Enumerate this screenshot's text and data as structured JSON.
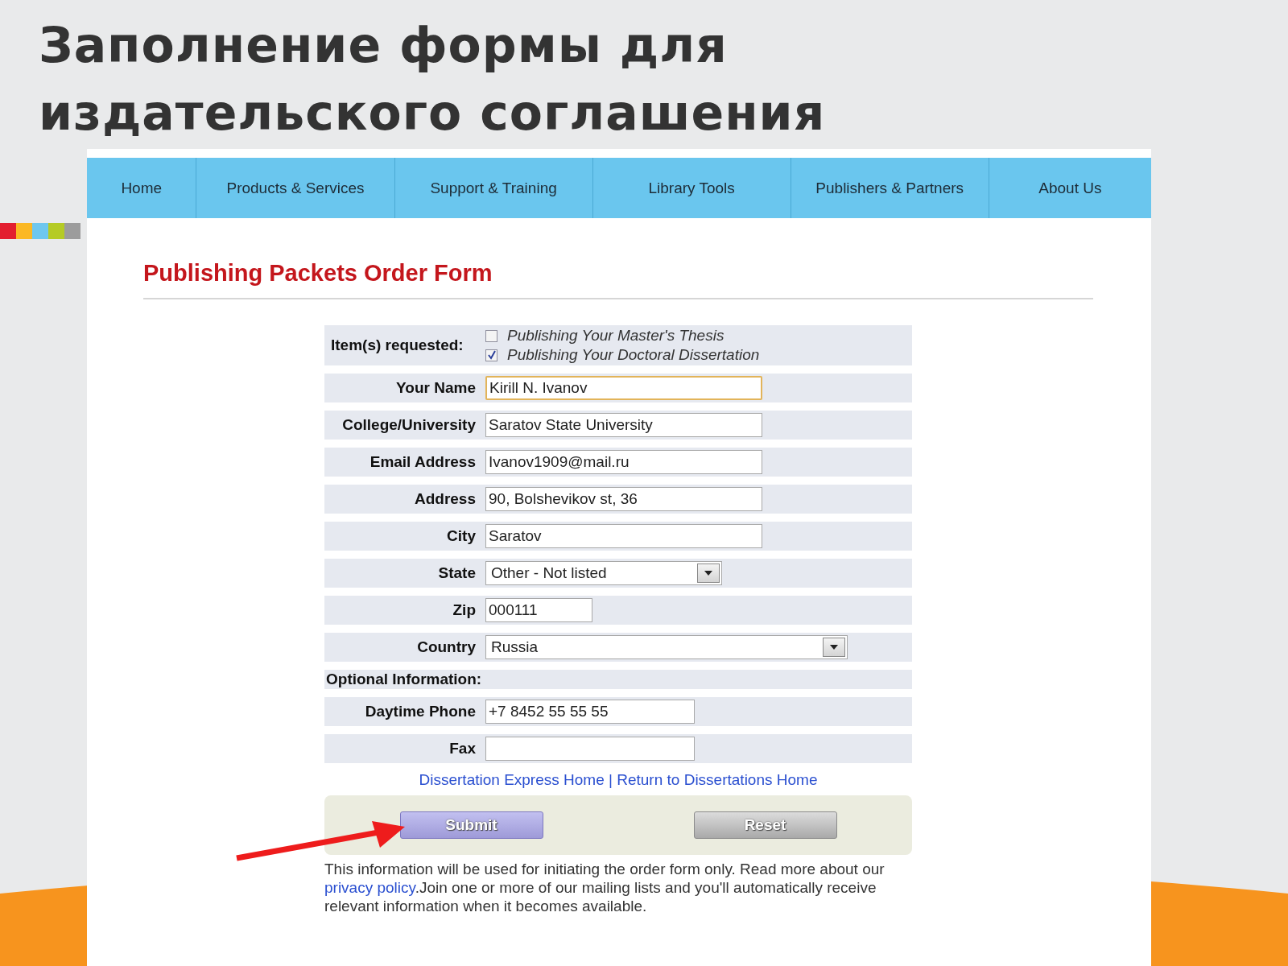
{
  "slide_title": "Заполнение формы для издательского соглашения",
  "nav": [
    {
      "label": "Home"
    },
    {
      "label": "Products & Services"
    },
    {
      "label": "Support & Training"
    },
    {
      "label": "Library Tools"
    },
    {
      "label": "Publishers & Partners"
    },
    {
      "label": "About Us"
    }
  ],
  "form_title": "Publishing Packets Order Form",
  "items_requested": {
    "label": "Item(s) requested:",
    "options": [
      {
        "label": "Publishing Your Master's Thesis",
        "checked": false
      },
      {
        "label": "Publishing Your Doctoral Dissertation",
        "checked": true
      }
    ]
  },
  "fields": [
    {
      "kind": "text",
      "label": "Your Name",
      "value": "Kirill N. Ivanov",
      "focused": true
    },
    {
      "kind": "text",
      "label": "College/University",
      "value": "Saratov State University",
      "focused": false
    },
    {
      "kind": "text",
      "label": "Email Address",
      "value": "Ivanov1909@mail.ru",
      "focused": false
    },
    {
      "kind": "text",
      "label": "Address",
      "value": "90, Bolshevikov st, 36",
      "focused": false
    },
    {
      "kind": "text",
      "label": "City",
      "value": "Saratov",
      "focused": false
    },
    {
      "kind": "select",
      "label": "State",
      "value": "Other - Not listed",
      "focused": false
    },
    {
      "kind": "text",
      "label": "Zip",
      "value": "000111",
      "focused": false
    },
    {
      "kind": "select",
      "label": "Country",
      "value": "Russia",
      "focused": false
    }
  ],
  "optional_heading": "Optional Information:",
  "optional_fields": [
    {
      "kind": "text",
      "label": "Daytime Phone",
      "value": "+7 8452 55 55 55",
      "focused": false
    },
    {
      "kind": "text",
      "label": "Fax",
      "focused": false
    }
  ],
  "links": [
    "Dissertation Express Home",
    "Return to Dissertations Home"
  ],
  "link_separator": "|",
  "buttons": [
    {
      "label": "Submit",
      "kind": "primary"
    },
    {
      "label": "Reset",
      "kind": "secondary"
    }
  ],
  "notice": {
    "before": "This information will be used for initiating the order form only. Read more about our ",
    "link": "privacy policy",
    "after": ".Join one or more of our mailing lists and you'll automatically receive relevant information when it becomes available."
  }
}
